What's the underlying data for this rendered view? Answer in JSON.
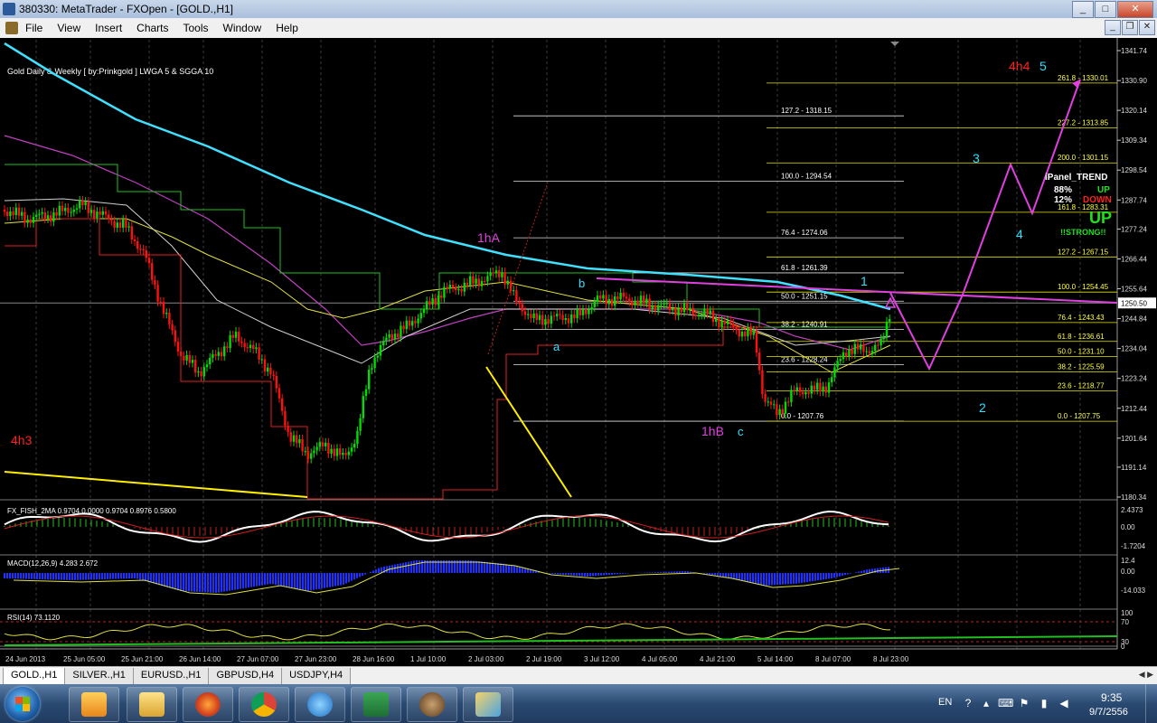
{
  "window": {
    "title": "380330: MetaTrader - FXOpen - [GOLD.,H1]"
  },
  "menu": [
    "File",
    "View",
    "Insert",
    "Charts",
    "Tools",
    "Window",
    "Help"
  ],
  "chart": {
    "header": "Gold Daily & Weekly  [ by:Prinkgold ]  LWGA 5  &  SGGA 10",
    "current_price": "1250.50",
    "price_axis": [
      "1341.74",
      "1330.90",
      "1320.14",
      "1309.34",
      "1298.54",
      "1287.74",
      "1277.24",
      "1266.44",
      "1255.64",
      "1244.84",
      "1234.04",
      "1223.24",
      "1212.44",
      "1201.64",
      "1191.14",
      "1180.34"
    ],
    "time_axis": [
      "24 Jun 2013",
      "25 Jun 05:00",
      "25 Jun 21:00",
      "26 Jun 14:00",
      "27 Jun 07:00",
      "27 Jun 23:00",
      "28 Jun 16:00",
      "1 Jul 10:00",
      "2 Jul 03:00",
      "2 Jul 19:00",
      "3 Jul 12:00",
      "4 Jul 05:00",
      "4 Jul 21:00",
      "5 Jul 14:00",
      "8 Jul 07:00",
      "8 Jul 23:00"
    ],
    "fib_left": [
      "127.2 - 1318.15",
      "100.0 - 1294.54",
      "76.4 - 1274.06",
      "61.8 - 1261.39",
      "50.0 - 1251.15",
      "38.2 - 1240.91",
      "23.6 - 1228.24",
      "0.0 - 1207.76"
    ],
    "fib_right": [
      "261.8 - 1330.01",
      "227.2 - 1313.85",
      "200.0 - 1301.15",
      "161.8 - 1283.31",
      "127.2 - 1267.15",
      "100.0 - 1254.45",
      "76.4 - 1243.43",
      "61.8 - 1236.61",
      "50.0 - 1231.10",
      "38.2 - 1225.59",
      "23.6 - 1218.77",
      "0.0 - 1207.75"
    ],
    "wave_labels": [
      "4h4",
      "5",
      "3",
      "4",
      "1",
      "2",
      "1hA",
      "1hB",
      "a",
      "b",
      "c",
      "4h3"
    ],
    "panel": {
      "title": "iPanel_TREND",
      "pct_up": "88%",
      "pct_down": "12%",
      "up": "UP",
      "down": "DOWN",
      "big": "UP",
      "strong": "!!STRONG!!"
    },
    "fish": {
      "label": "FX_FISH_2MA 0.9704 0.0000 0.9704 0.8976 0.5800",
      "axis": [
        "2.4373",
        "0.00",
        "-1.7204"
      ]
    },
    "macd": {
      "label": "MACD(12,26,9) 4.283 2.672",
      "axis": [
        "12.4",
        "0.00",
        "-14.033"
      ]
    },
    "rsi": {
      "label": "RSI(14) 73.1120",
      "axis": [
        "100",
        "70",
        "30",
        "0"
      ]
    }
  },
  "tabs": [
    "GOLD.,H1",
    "SILVER.,H1",
    "EURUSD.,H1",
    "GBPUSD,H4",
    "USDJPY,H4"
  ],
  "tray": {
    "lang": "EN",
    "time": "9:35",
    "date": "9/7/2556"
  },
  "colors": {
    "bg": "#000000",
    "bull": "#00e000",
    "bear": "#ff0000",
    "cyan": "#00e5ff",
    "magenta": "#e000e0"
  }
}
